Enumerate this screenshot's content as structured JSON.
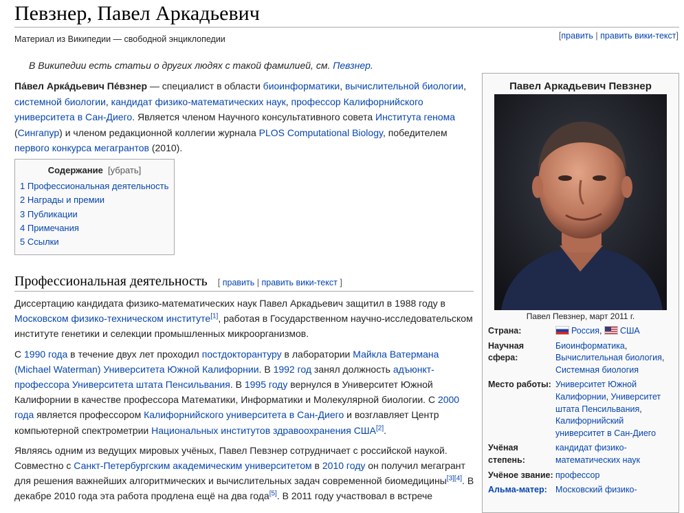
{
  "title": "Певзнер, Павел Аркадьевич",
  "site_sub": "Материал из Википедии — свободной энциклопедии",
  "top_edit": {
    "open": "[",
    "edit": "править",
    "sep": " | ",
    "edit_wiki": "править вики-текст",
    "close": "]"
  },
  "hatnote": {
    "text": "В Википедии есть статьи о других людях с такой фамилией, см. ",
    "link": "Певзнер",
    "end": "."
  },
  "intro": {
    "name_bold": "Па́вел Арка́дьевич Пе́взнер",
    "t1": " — специалист в области ",
    "l1": "биоинформатики",
    "t2": ", ",
    "l2": "вычислительной биологии",
    "t3": ", ",
    "l3": "системной биологии",
    "t4": ", ",
    "l4": "кандидат физико-математических наук",
    "t5": ", ",
    "l5": "профессор Калифорнийского университета в Сан-Диего",
    "t6": ". Является членом Научного консультативного совета ",
    "l6": "Института генома",
    "t7": " (",
    "l7": "Сингапур",
    "t8": ") и членом редакционной коллегии журнала ",
    "l8": "PLOS Computational Biology",
    "t9": ", победителем ",
    "l9": "первого конкурса мегагрантов",
    "t10": " (2010)."
  },
  "toc": {
    "title": "Содержание",
    "hide": "[убрать]",
    "items": [
      {
        "num": "1",
        "label": "Профессиональная деятельность"
      },
      {
        "num": "2",
        "label": "Награды и премии"
      },
      {
        "num": "3",
        "label": "Публикации"
      },
      {
        "num": "4",
        "label": "Примечания"
      },
      {
        "num": "5",
        "label": "Ссылки"
      }
    ]
  },
  "section1": {
    "heading": "Профессиональная деятельность",
    "edit_open": "[ ",
    "edit": "править",
    "sep": " | ",
    "edit_wiki": "править вики-текст",
    "edit_close": " ]"
  },
  "para1": {
    "t1": "Диссертацию кандидата физико-математических наук Павел Аркадьевич защитил в 1988 году в ",
    "l1": "Московском физико-техническом институте",
    "s1": "[1]",
    "t2": ", работая в Государственном научно-исследовательском институте генетики и селекции промышленных микроорганизмов."
  },
  "para2": {
    "t1": "С ",
    "l1": "1990 года",
    "t2": " в течение двух лет проходил ",
    "l2": "постдокторантуру",
    "t3": " в лаборатории ",
    "l3": "Майкла Ватермана (Michael Waterman)",
    "t4": " ",
    "l4": "Университета Южной Калифорнии",
    "t5": ". В ",
    "l5": "1992 год",
    "t6": " занял должность ",
    "l6": "адъюнкт-профессора",
    "t7": " ",
    "l7": "Университета штата Пенсильвания",
    "t8": ". В ",
    "l8": "1995 году",
    "t9": " вернулся в Университет Южной Калифорнии в качестве профессора Математики, Информатики и Молекулярной биологии. С ",
    "l9": "2000 года",
    "t10": " является профессором ",
    "l10": "Калифорнийского университета в Сан-Диего",
    "t11": " и возглавляет Центр компьютерной спектрометрии ",
    "l11": "Национальных институтов здравоохранения США",
    "s1": "[2]",
    "t12": "."
  },
  "para3": {
    "t1": "Являясь одним из ведущих мировых учёных, Павел Певзнер сотрудничает с российской наукой. Совместно с ",
    "l1": "Санкт-Петербургским академическим университетом",
    "t2": " в ",
    "l2": "2010 году",
    "t3": " он получил мегагрант для решения важнейших алгоритмических и вычислительных задач современной биомедицины",
    "s1": "[3]",
    "s2": "[4]",
    "t4": ".",
    "t5": "В декабре 2010 года эта работа продлена ещё на два года",
    "s3": "[5]",
    "t6": ". В 2011 году участвовал в встрече"
  },
  "infobox": {
    "title": "Павел Аркадьевич Певзнер",
    "caption": "Павел Певзнер, март 2011 г.",
    "country_label": "Страна:",
    "country_1": "Россия",
    "country_sep": ", ",
    "country_2": "США",
    "field_label": "Научная сфера:",
    "field_1": "Биоинформатика",
    "field_2": "Вычислительная биология",
    "field_3": "Системная биология",
    "work_label": "Место работы:",
    "work_1": "Университет Южной Калифорнии",
    "work_2": "Университет штата Пенсильвания",
    "work_3": "Калифорнийский университет в Сан-Диего",
    "degree_label": "Учёная степень:",
    "degree": "кандидат физико-математических наук",
    "rank_label": "Учёное звание:",
    "rank": "профессор",
    "alma_label": "Альма-матер:",
    "alma": "Московский физико-"
  }
}
